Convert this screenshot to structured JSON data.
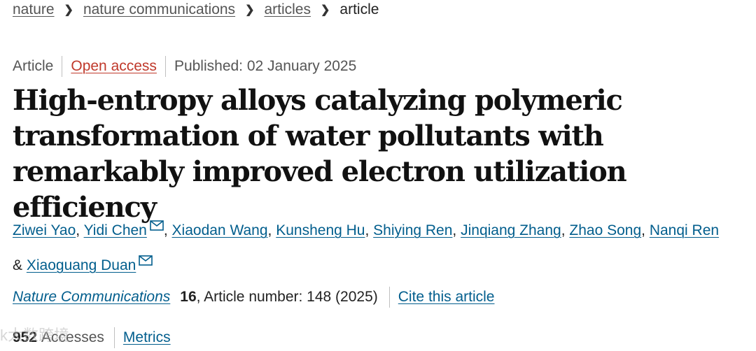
{
  "breadcrumb": {
    "items": [
      "nature",
      "nature communications",
      "articles"
    ],
    "current": "article"
  },
  "meta": {
    "type": "Article",
    "access": "Open access",
    "published": "Published: 02 January 2025"
  },
  "title": "High-entropy alloys catalyzing polymeric transformation of water pollutants with remarkably improved electron utilization efficiency",
  "authors": {
    "list": [
      "Ziwei Yao",
      "Yidi Chen",
      "Xiaodan Wang",
      "Kunsheng Hu",
      "Shiying Ren",
      "Jinqiang Zhang",
      "Zhao Song",
      "Nanqi Ren"
    ],
    "last": "Xiaoguang Duan",
    "ampersand": "&",
    "comma": ","
  },
  "citation": {
    "journal": "Nature Communications",
    "volume": "16",
    "article_number": ", Article number: 148 (2025)",
    "cite_link": "Cite this article"
  },
  "metrics": {
    "accesses_count": "952",
    "accesses_label": "Accesses",
    "metrics_link": "Metrics"
  },
  "watermark": "k大数跨境"
}
